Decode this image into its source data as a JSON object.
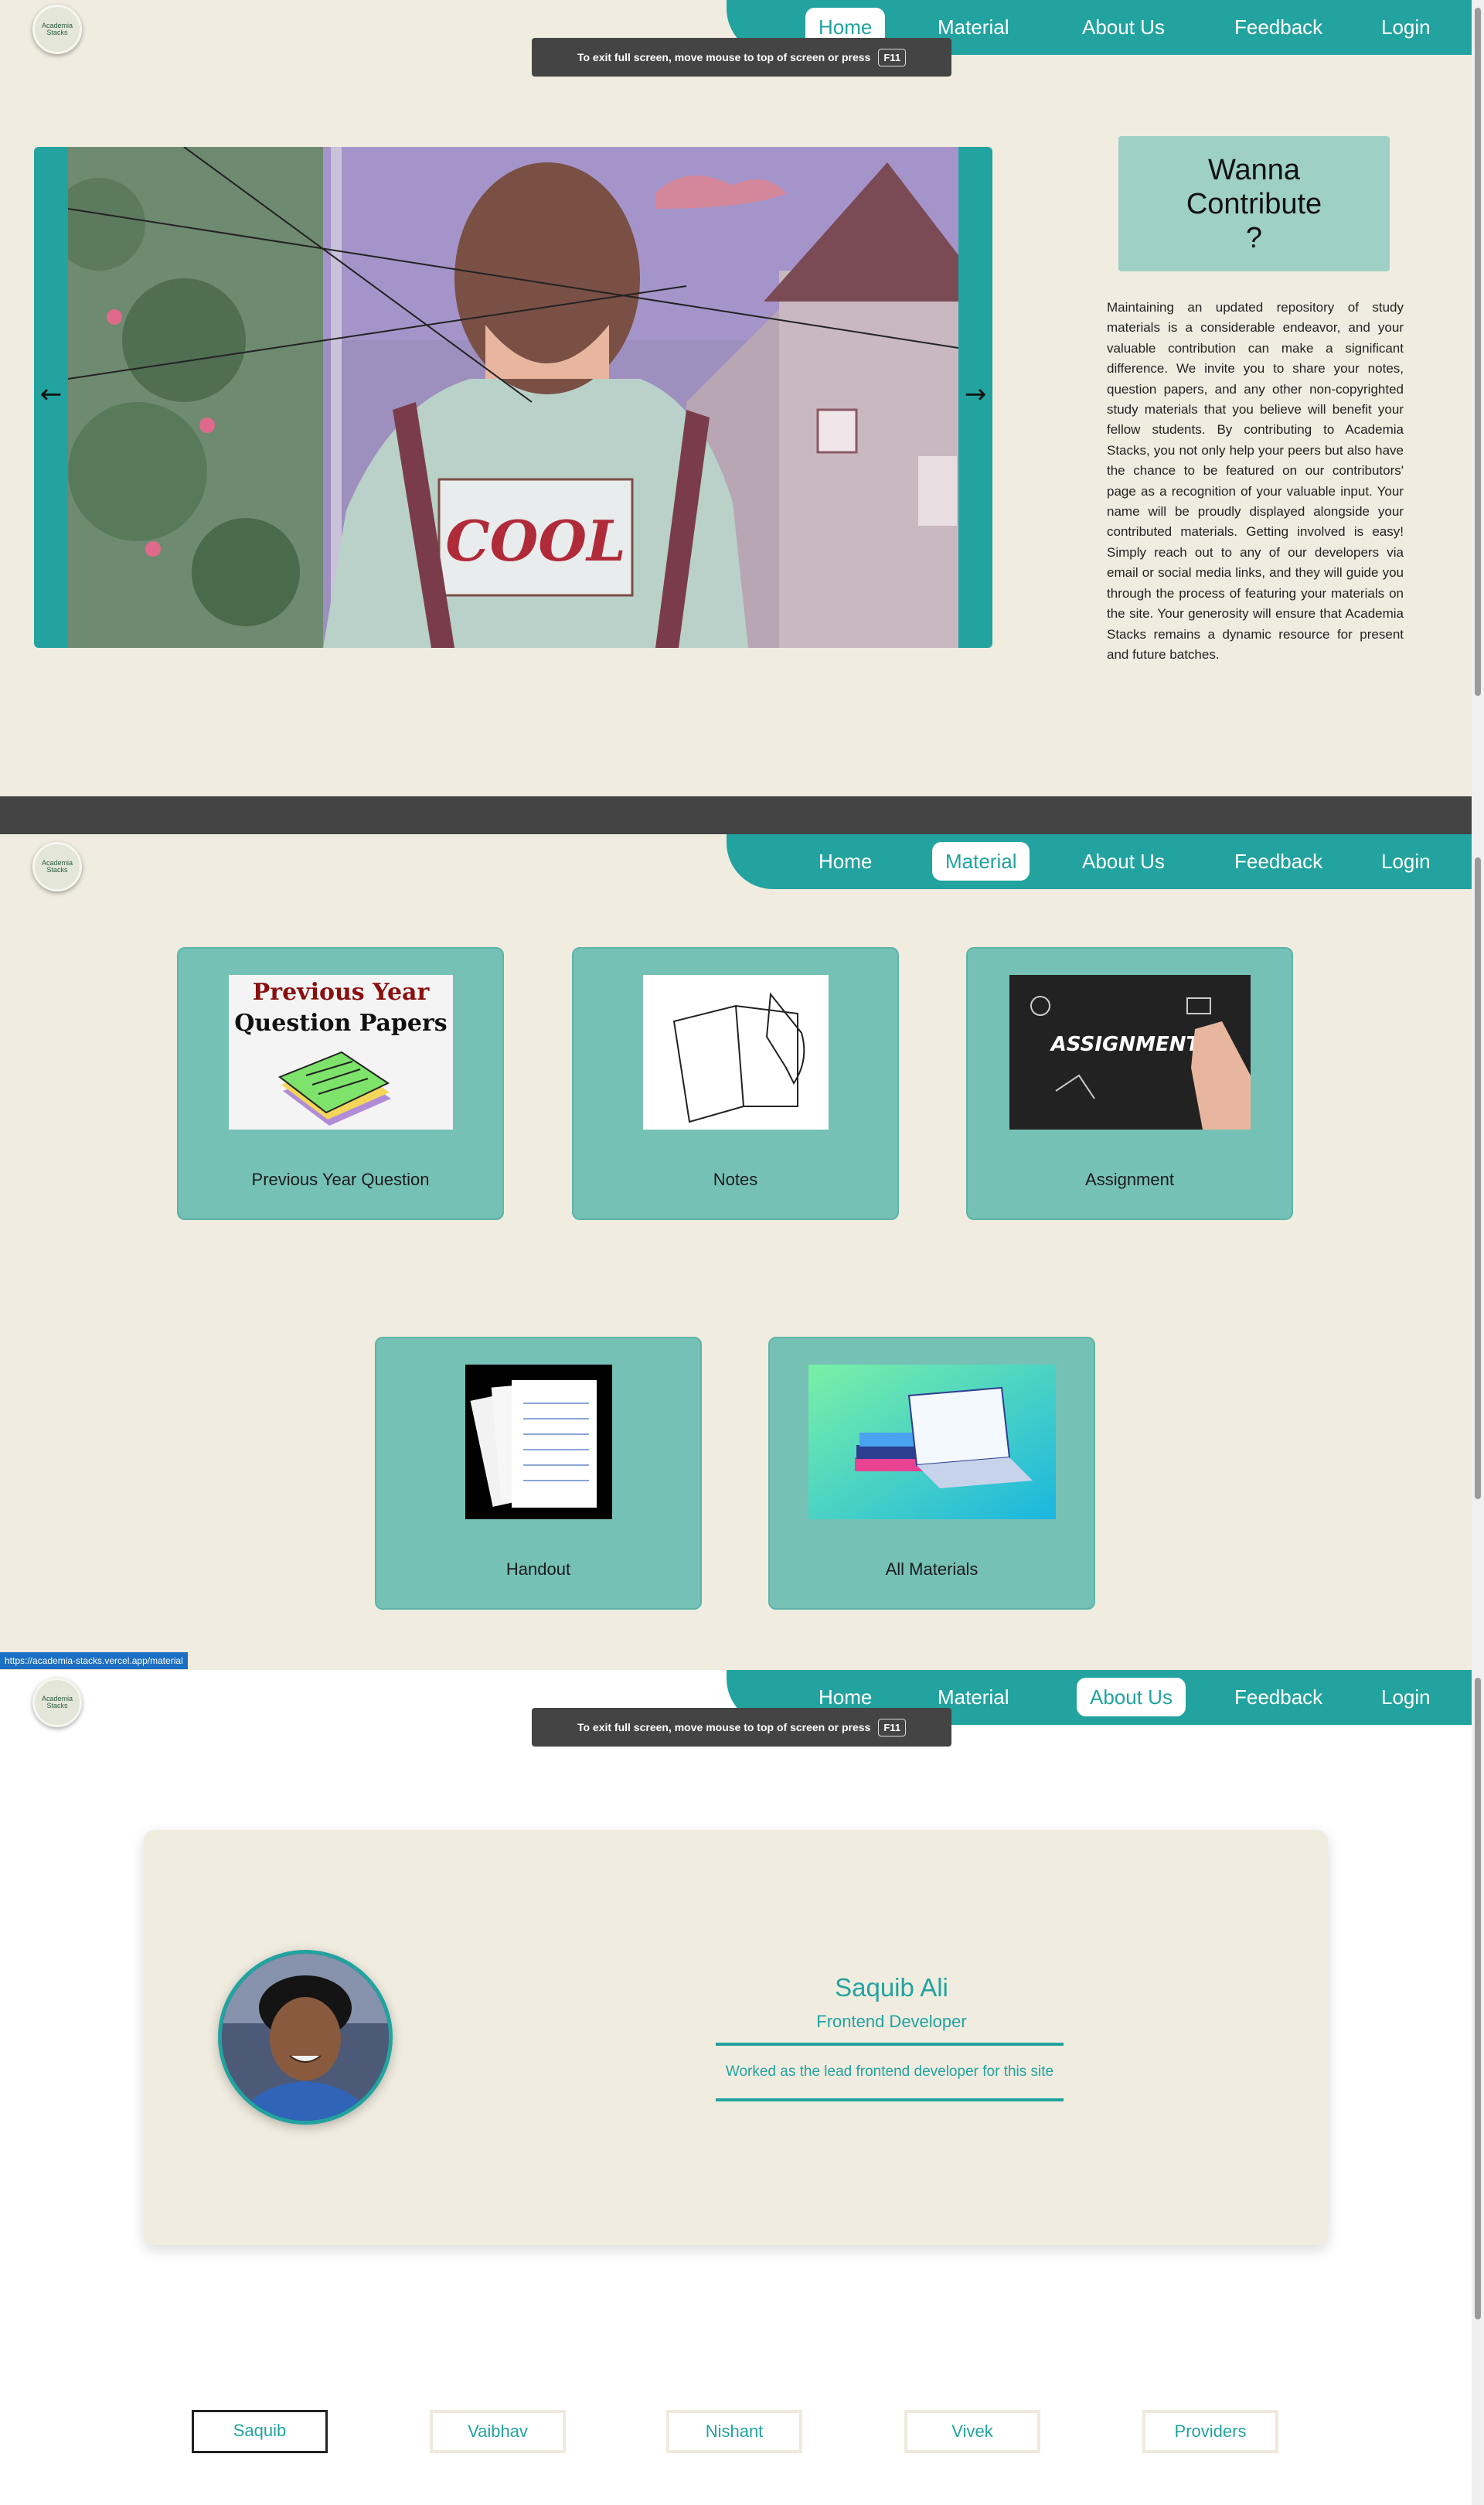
{
  "nav": {
    "logo_text": "Academia Stacks",
    "items": [
      "Home",
      "Material",
      "About Us",
      "Feedback",
      "Login"
    ]
  },
  "fullscreen_notice": {
    "text": "To exit full screen, move mouse to top of screen or press",
    "key": "F11"
  },
  "home": {
    "carousel": {
      "prev_icon": "←",
      "next_icon": "→",
      "sign_text": "COOL"
    },
    "contribute_title": "Wanna Contribute ?",
    "contribute_text": "Maintaining an updated repository of study materials is a considerable endeavor, and your valuable contribution can make a significant difference. We invite you to share your notes, question papers, and any other non-copyrighted study materials that you believe will benefit your fellow students. By contributing to Academia Stacks, you not only help your peers but also have the chance to be featured on our contributors' page as a recognition of your valuable input. Your name will be proudly displayed alongside your contributed materials. Getting involved is easy! Simply reach out to any of our developers via email or social media links, and they will guide you through the process of featuring your materials on the site. Your generosity will ensure that Academia Stacks remains a dynamic resource for present and future batches."
  },
  "material": {
    "cards": [
      {
        "label": "Previous Year Question",
        "thumb_line1": "Previous Year",
        "thumb_line2": "Question Papers"
      },
      {
        "label": "Notes"
      },
      {
        "label": "Assignment",
        "thumb_text": "ASSIGNMENT"
      },
      {
        "label": "Handout"
      },
      {
        "label": "All Materials"
      }
    ],
    "status_url": "https://academia-stacks.vercel.app/material"
  },
  "about": {
    "name": "Saquib Ali",
    "role": "Frontend Developer",
    "description": "Worked as the lead frontend developer for this site",
    "team": [
      "Saquib",
      "Vaibhav",
      "Nishant",
      "Vivek",
      "Providers"
    ]
  },
  "colors": {
    "teal": "#22a39f",
    "cream": "#f0ece0",
    "card": "#76c1b6",
    "contribute_box": "#9fd0c6"
  }
}
